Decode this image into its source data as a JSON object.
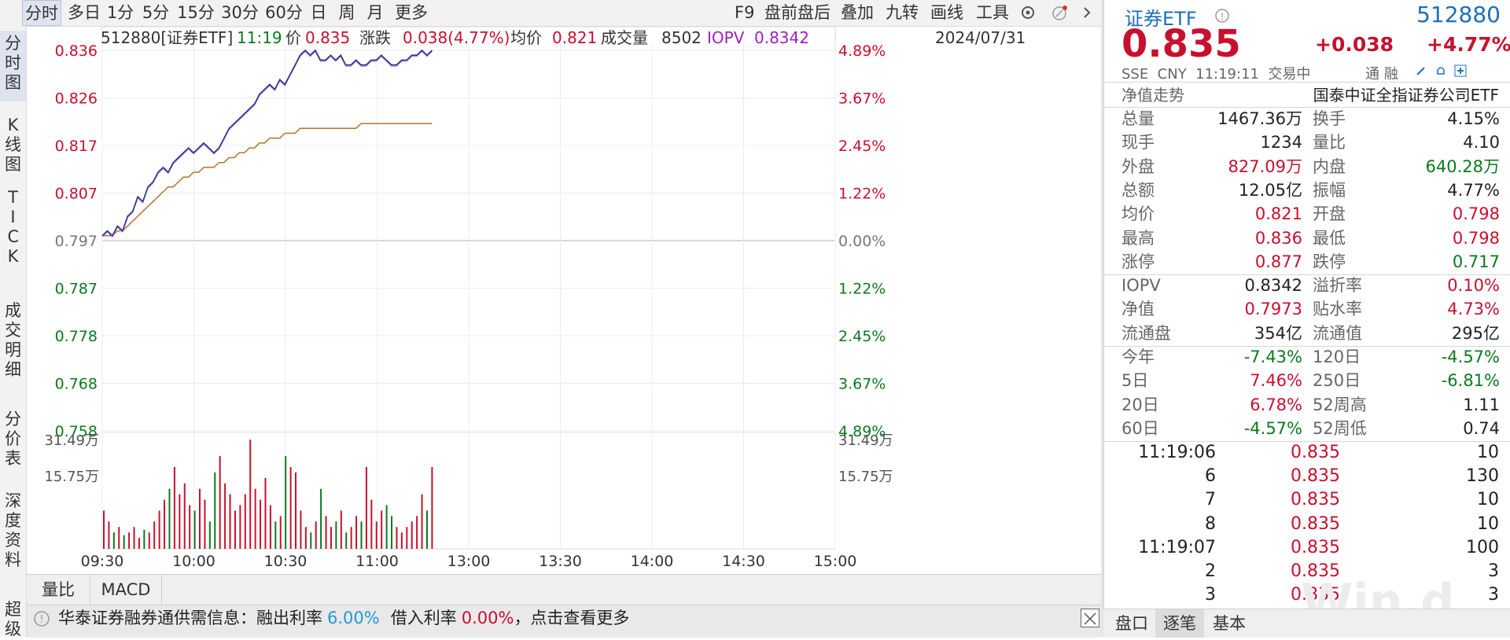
{
  "toolbar": {
    "tabs": [
      "分时",
      "多日",
      "1分",
      "5分",
      "15分",
      "30分",
      "60分",
      "日",
      "周",
      "月",
      "更多"
    ],
    "right": [
      "F9",
      "盘前盘后",
      "叠加",
      "九转",
      "画线",
      "工具"
    ]
  },
  "vtabs": [
    "分时图",
    "K线图",
    "TICK",
    "成交明细",
    "分价表",
    "深度资料",
    "超级"
  ],
  "infobar": {
    "code": "512880[证券ETF]",
    "time": "11:19",
    "price_label": "价",
    "price": "0.835",
    "change_label": "涨跌",
    "change": "0.038(4.77%)",
    "avg_label": "均价",
    "avg": "0.821",
    "vol_label": "成交量",
    "vol": "8502",
    "iopv_label": "IOPV",
    "iopv": "0.8342",
    "date": "2024/07/31"
  },
  "chart_data": {
    "type": "line",
    "title": "",
    "prev_close": 0.797,
    "y_left_ticks": [
      "0.836",
      "0.826",
      "0.817",
      "0.807",
      "0.797",
      "0.787",
      "0.778",
      "0.768",
      "0.758"
    ],
    "y_right_ticks": [
      "4.89%",
      "3.67%",
      "2.45%",
      "1.22%",
      "0.00%",
      "1.22%",
      "2.45%",
      "3.67%",
      "4.89%"
    ],
    "vol_ticks": [
      "31.49万",
      "15.75万"
    ],
    "x_ticks": [
      "09:30",
      "10:00",
      "10:30",
      "11:00",
      "13:00",
      "13:30",
      "14:00",
      "14:30",
      "15:00"
    ],
    "price_series": [
      0.798,
      0.799,
      0.798,
      0.8,
      0.799,
      0.802,
      0.803,
      0.806,
      0.805,
      0.808,
      0.809,
      0.811,
      0.812,
      0.811,
      0.813,
      0.814,
      0.815,
      0.816,
      0.815,
      0.816,
      0.817,
      0.816,
      0.815,
      0.816,
      0.818,
      0.82,
      0.821,
      0.822,
      0.823,
      0.824,
      0.825,
      0.827,
      0.828,
      0.829,
      0.828,
      0.83,
      0.829,
      0.831,
      0.833,
      0.835,
      0.836,
      0.835,
      0.836,
      0.834,
      0.834,
      0.835,
      0.834,
      0.835,
      0.833,
      0.833,
      0.834,
      0.833,
      0.833,
      0.834,
      0.834,
      0.835,
      0.834,
      0.833,
      0.833,
      0.834,
      0.834,
      0.835,
      0.835,
      0.836,
      0.835,
      0.836
    ],
    "avg_series": [
      0.798,
      0.798,
      0.798,
      0.799,
      0.799,
      0.8,
      0.801,
      0.802,
      0.803,
      0.804,
      0.805,
      0.806,
      0.807,
      0.808,
      0.808,
      0.809,
      0.81,
      0.81,
      0.811,
      0.811,
      0.812,
      0.812,
      0.812,
      0.813,
      0.813,
      0.814,
      0.814,
      0.815,
      0.815,
      0.816,
      0.816,
      0.817,
      0.817,
      0.818,
      0.818,
      0.818,
      0.819,
      0.819,
      0.819,
      0.82,
      0.82,
      0.82,
      0.82,
      0.82,
      0.82,
      0.82,
      0.82,
      0.82,
      0.82,
      0.82,
      0.82,
      0.821,
      0.821,
      0.821,
      0.821,
      0.821,
      0.821,
      0.821,
      0.821,
      0.821,
      0.821,
      0.821,
      0.821,
      0.821,
      0.821,
      0.821
    ],
    "volume_max": 31.49,
    "volume_series": [
      14,
      10,
      6,
      8,
      5,
      6,
      8,
      4,
      7,
      6,
      10,
      14,
      18,
      22,
      30,
      20,
      24,
      16,
      14,
      22,
      18,
      10,
      28,
      34,
      24,
      20,
      14,
      16,
      20,
      40,
      22,
      18,
      26,
      16,
      10,
      12,
      34,
      30,
      28,
      14,
      8,
      6,
      10,
      22,
      12,
      8,
      10,
      14,
      6,
      8,
      12,
      10,
      30,
      18,
      10,
      14,
      16,
      12,
      8,
      6,
      8,
      10,
      12,
      20,
      14,
      30
    ]
  },
  "btabs": [
    "量比",
    "MACD"
  ],
  "news": {
    "text1": "华泰证券融券通供需信息：融出利率",
    "rate1": "6.00%",
    "text2": "借入利率",
    "rate2": "0.00%",
    "text3": "，点击查看更多"
  },
  "quote": {
    "name": "证券ETF",
    "code": "512880",
    "price": "0.835",
    "change": "+0.038",
    "pct": "+4.77%",
    "meta": "SSE  CNY  11:19:11  交易中",
    "rong": "通 融",
    "nav_trend": "净值走势",
    "fund_name": "国泰中证全指证券公司ETF"
  },
  "stats": [
    {
      "l1": "总量",
      "v1": "1467.36万",
      "c1": "",
      "l2": "换手",
      "v2": "4.15%",
      "c2": ""
    },
    {
      "l1": "现手",
      "v1": "1234",
      "c1": "",
      "l2": "量比",
      "v2": "4.10",
      "c2": ""
    },
    {
      "l1": "外盘",
      "v1": "827.09万",
      "c1": "red",
      "l2": "内盘",
      "v2": "640.28万",
      "c2": "green"
    },
    {
      "l1": "总额",
      "v1": "12.05亿",
      "c1": "",
      "l2": "振幅",
      "v2": "4.77%",
      "c2": ""
    },
    {
      "l1": "均价",
      "v1": "0.821",
      "c1": "red",
      "l2": "开盘",
      "v2": "0.798",
      "c2": "red"
    },
    {
      "l1": "最高",
      "v1": "0.836",
      "c1": "red",
      "l2": "最低",
      "v2": "0.798",
      "c2": "red"
    },
    {
      "l1": "涨停",
      "v1": "0.877",
      "c1": "red",
      "l2": "跌停",
      "v2": "0.717",
      "c2": "green"
    },
    {
      "l1": "IOPV",
      "v1": "0.8342",
      "c1": "",
      "l2": "溢折率",
      "v2": "0.10%",
      "c2": "red"
    },
    {
      "l1": "净值",
      "v1": "0.7973",
      "c1": "red",
      "l2": "贴水率",
      "v2": "4.73%",
      "c2": "red"
    },
    {
      "l1": "流通盘",
      "v1": "354亿",
      "c1": "",
      "l2": "流通值",
      "v2": "295亿",
      "c2": ""
    },
    {
      "l1": "今年",
      "v1": "-7.43%",
      "c1": "green",
      "l2": "120日",
      "v2": "-4.57%",
      "c2": "green"
    },
    {
      "l1": "5日",
      "v1": "7.46%",
      "c1": "red",
      "l2": "250日",
      "v2": "-6.81%",
      "c2": "green"
    },
    {
      "l1": "20日",
      "v1": "6.78%",
      "c1": "red",
      "l2": "52周高",
      "v2": "1.11",
      "c2": ""
    },
    {
      "l1": "60日",
      "v1": "-4.57%",
      "c1": "green",
      "l2": "52周低",
      "v2": "0.74",
      "c2": ""
    }
  ],
  "ticks": [
    {
      "t": "11:19:06",
      "p": "0.835",
      "v": "10"
    },
    {
      "t": "6",
      "p": "0.835",
      "v": "130"
    },
    {
      "t": "7",
      "p": "0.835",
      "v": "10"
    },
    {
      "t": "8",
      "p": "0.835",
      "v": "10"
    },
    {
      "t": "11:19:07",
      "p": "0.835",
      "v": "100"
    },
    {
      "t": "2",
      "p": "0.835",
      "v": "3"
    },
    {
      "t": "3",
      "p": "0.835",
      "v": "3"
    }
  ],
  "rbottabs": [
    "盘口",
    "逐笔",
    "基本"
  ],
  "watermark": "Win.d",
  "colors": {
    "up": "#c8102e",
    "down": "#0a7a1e",
    "price_line": "#1f3a8a",
    "avg_line": "#b8732a",
    "iopv": "#a020c0",
    "accent": "#1e6fb8"
  }
}
